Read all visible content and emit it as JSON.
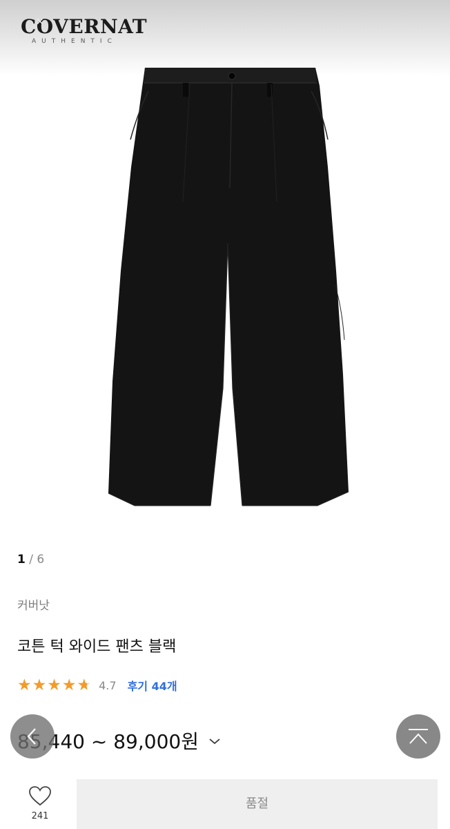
{
  "brand": {
    "name": "COVERNAT",
    "sub": "AUTHENTIC"
  },
  "pager": {
    "current": "1",
    "separator": "/",
    "total": "6"
  },
  "product": {
    "brand_label": "커버낫",
    "title": "코튼 턱 와이드 팬츠 블랙",
    "rating_value": 4.7,
    "rating_text": "4.7",
    "review_link": "후기 44개",
    "price_range": "85,440 ~ 89,000원"
  },
  "actions": {
    "wishlist_count": "241",
    "soldout_label": "품절"
  },
  "icons": {
    "rating": "star-icon",
    "expand": "chevron-down-icon",
    "back": "chevron-left-icon",
    "top": "scroll-to-top-icon",
    "wishlist": "heart-icon"
  },
  "colors": {
    "star": "#f39b2a",
    "review_link": "#2f6fe0",
    "soldout_bg": "#efefef"
  }
}
